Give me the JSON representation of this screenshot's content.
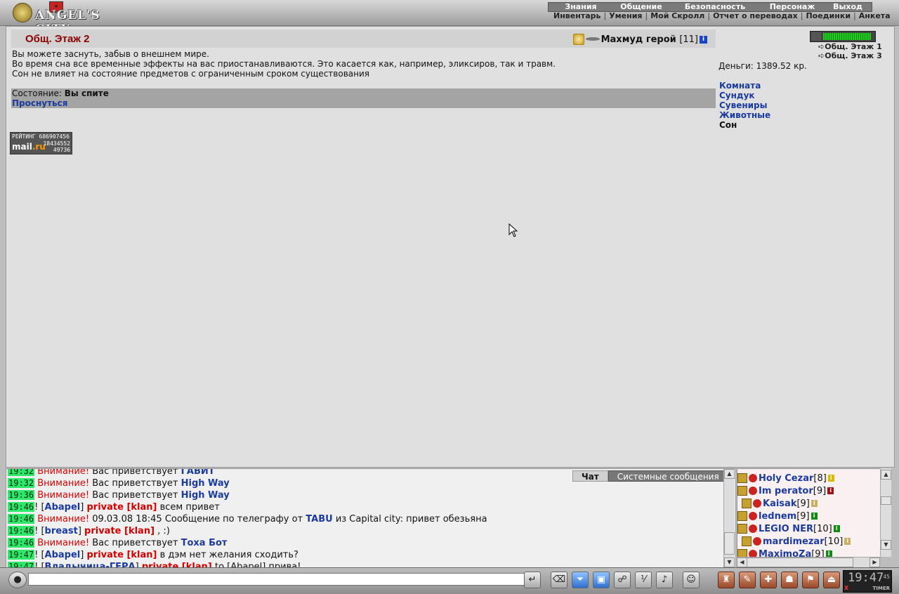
{
  "header": {
    "logo_text": "ANGEL'S CITY",
    "main_menu": [
      "Знания",
      "Общение",
      "Безопасность",
      "Персонаж",
      "Выход"
    ],
    "sub_menu": [
      "Инвентарь",
      "Умения",
      "Мой Скролл",
      "Отчет о переводах",
      "Поединки",
      "Анкета"
    ]
  },
  "room": {
    "title": "Общ. Этаж 2",
    "player_name": "Махмуд герой",
    "player_level": "[11]",
    "info_badge": "i",
    "notice": [
      "Вы можете заснуть, забыв о внешнем мире.",
      "Во время сна все временные эффекты на вас приостанавливаются. Это касается как, например, эликсиров, так и травм.",
      "Сон не влияет на состояние предметов с ограниченным сроком существования"
    ],
    "status_label": "Состояние:",
    "status_value": "Вы спите",
    "wake_link": "Проснуться"
  },
  "rating": {
    "label": "РЕЙТИНГ",
    "top_number": "686907456",
    "brand_mail": "mail",
    "brand_ru": ".ru",
    "num2": "18434552",
    "num3": "49736"
  },
  "sidebar": {
    "hp_fraction": 0.95,
    "exits": [
      "Общ. Этаж 1",
      "Общ. Этаж 3"
    ],
    "money": "Деньги: 1389.52 кр.",
    "rooms": [
      "Комната",
      "Сундук",
      "Сувениры",
      "Животные"
    ],
    "current_room": "Сон"
  },
  "chat": {
    "tab_chat": "Чат",
    "tab_system": "Системные сообщения",
    "lines": [
      {
        "time": "19:32",
        "type": "attn",
        "attn": "Внимание!",
        "text": "Вас приветствует",
        "nick": "ГАВИТ"
      },
      {
        "time": "19:32",
        "type": "attn",
        "attn": "Внимание!",
        "text": "Вас приветствует",
        "nick": "High Way"
      },
      {
        "time": "19:36",
        "type": "attn",
        "attn": "Внимание!",
        "text": "Вас приветствует",
        "nick": "High Way"
      },
      {
        "time": "19:46",
        "type": "priv",
        "from": "Abapel",
        "priv": "private [klan]",
        "text": "всем привет"
      },
      {
        "time": "19:46",
        "type": "telegraph",
        "attn": "Внимание!",
        "text": "09.03.08 18:45 Сообщение по телеграфу от",
        "nick": "TABU",
        "tail": "из Capital city: привет обезьяна"
      },
      {
        "time": "19:46",
        "type": "priv",
        "from": "breast",
        "priv": "private [klan]",
        "text": ", :)"
      },
      {
        "time": "19:46",
        "type": "attn",
        "attn": "Внимание!",
        "text": "Вас приветствует",
        "nick": "Тоха Бот"
      },
      {
        "time": "19:47",
        "type": "priv",
        "from": "Abapel",
        "priv": "private [klan]",
        "text": "в дэм нет желания сходить?"
      },
      {
        "time": "19:47",
        "type": "priv",
        "from": "Владычица-ГЕРА",
        "priv": "private [klan]",
        "text": "to [Abapel] прива!"
      }
    ]
  },
  "online": [
    {
      "name": "Holy Cezar",
      "level": "[8]",
      "info": "i",
      "info_color": "#d8b800"
    },
    {
      "name": "Im perator",
      "level": "[9]",
      "info": "i",
      "info_color": "#a01010"
    },
    {
      "name": "Kaisak",
      "level": "[9]",
      "info": "i",
      "info_color": "#c8b060"
    },
    {
      "name": "lednem",
      "level": "[9]",
      "info": "i",
      "info_color": "#108a10"
    },
    {
      "name": "LEGIO NER",
      "level": "[10]",
      "info": "i",
      "info_color": "#108a10"
    },
    {
      "name": "mardimezar",
      "level": "[10]",
      "info": "i",
      "info_color": "#c8b060"
    },
    {
      "name": "MaximoZa",
      "level": "[9]",
      "info": "i",
      "info_color": "#108a10"
    }
  ],
  "toolbar": {
    "input_value": "",
    "clock_time": "19:47",
    "clock_seconds": "45",
    "clock_label": "TIMER",
    "clock_x": "X",
    "icons": [
      "send-icon",
      "clear-icon",
      "filter-icon",
      "save-icon",
      "run-icon",
      "pl-icon",
      "sound-icon",
      "smile-icon",
      "bag-icon",
      "scroll-icon",
      "cross-icon",
      "group-icon",
      "flag-icon",
      "exit-icon"
    ]
  }
}
